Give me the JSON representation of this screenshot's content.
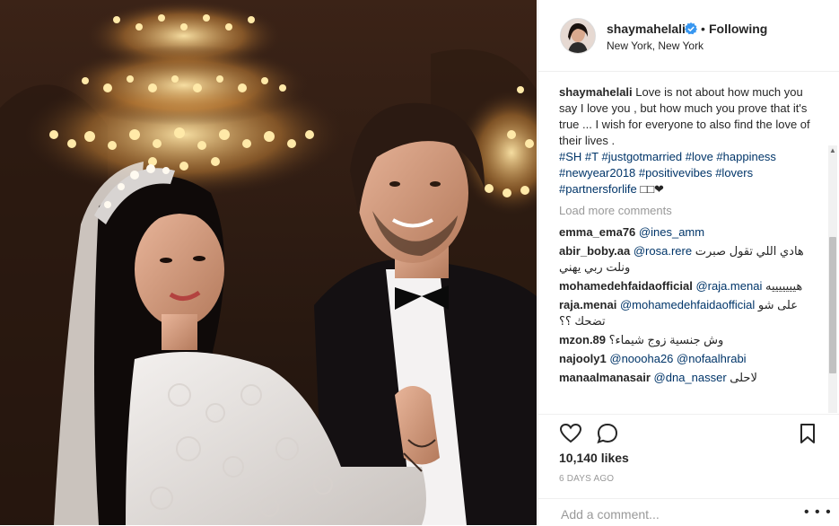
{
  "post": {
    "username": "shaymahelali",
    "separator": "•",
    "follow_status": "Following",
    "location": "New York, New York",
    "caption_text": "Love is not about how much you say I love you , but how much you prove that it's true ... I wish for everyone to also find the love of their lives .",
    "hashtags": [
      "#SH",
      "#T",
      "#justgotmarried",
      "#love",
      "#happiness",
      "#newyear2018",
      "#positivevibes",
      "#lovers",
      "#partnersforlife"
    ],
    "caption_trailing": "□□❤",
    "load_more": "Load more comments",
    "likes": "10,140 likes",
    "time_ago": "6 DAYS AGO",
    "add_comment_placeholder": "Add a comment...",
    "more_options": "• • •"
  },
  "comments": [
    {
      "user": "emma_ema76",
      "mention": "@ines_amm",
      "text": ""
    },
    {
      "user": "abir_boby.aa",
      "mention": "@rosa.rere",
      "text": "هادي اللي تقول صبرت ونلت ربي يهني",
      "pre": "هادي اللي تقول صبرت"
    },
    {
      "user": "mohamedehfaidaofficial",
      "mention": "@raja.menai",
      "text": "هيييييييه"
    },
    {
      "user": "raja.menai",
      "mention": "@mohamedehfaidaofficial",
      "text": "على شو تضحك ؟؟"
    },
    {
      "user": "mzon.89",
      "mention": "",
      "text": "وش جنسية زوج شيماء؟"
    },
    {
      "user": "najooly1",
      "mention": "@noooha26",
      "mention2": "@nofaalhrabi",
      "text": ""
    },
    {
      "user": "manaalmanasair",
      "mention": "@dna_nasser",
      "text": "لاحلى"
    }
  ],
  "icons": {
    "heart": "heart-icon",
    "comment": "comment-icon",
    "bookmark": "bookmark-icon",
    "verified": "verified-badge-icon"
  },
  "colors": {
    "link": "#003569",
    "muted": "#999999",
    "text": "#262626",
    "verified": "#3897f0"
  }
}
